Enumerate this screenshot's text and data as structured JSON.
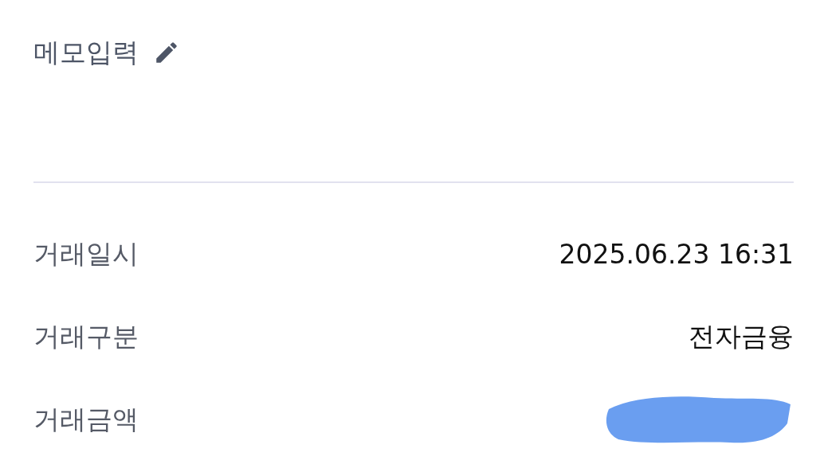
{
  "memo": {
    "label": "메모입력"
  },
  "details": [
    {
      "label": "거래일시",
      "kind": "text",
      "value": "2025.06.23 16:31"
    },
    {
      "label": "거래구분",
      "kind": "text",
      "value": "전자금융"
    },
    {
      "label": "거래금액",
      "kind": "redacted"
    }
  ]
}
